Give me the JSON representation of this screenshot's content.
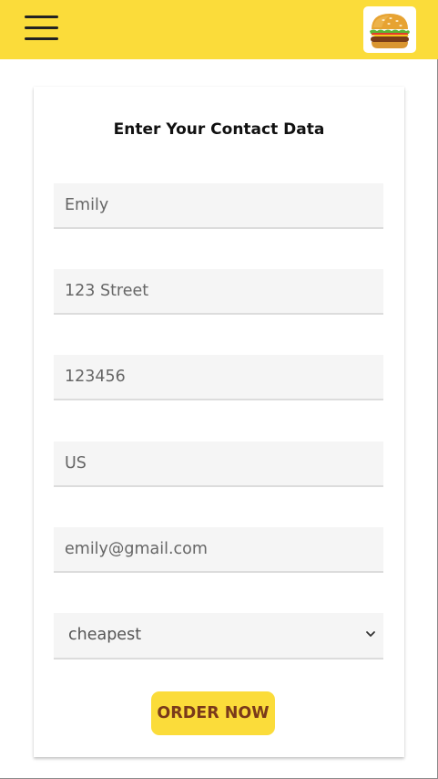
{
  "header": {
    "menu_icon": "hamburger-menu-icon",
    "logo_icon": "burger-icon",
    "background_color": "#fbdc3a"
  },
  "form": {
    "title": "Enter Your Contact Data",
    "name_value": "Emily",
    "address_value": "123 Street",
    "zip_value": "123456",
    "country_value": "US",
    "email_value": "emily@gmail.com",
    "delivery_selected": "cheapest",
    "submit_label": "ORDER NOW"
  },
  "colors": {
    "accent": "#fbdc3a",
    "button_text": "#7a3a1a"
  }
}
